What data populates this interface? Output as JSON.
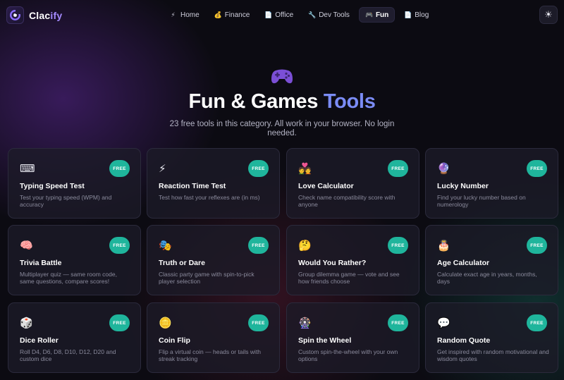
{
  "brand": {
    "name_main": "Clac",
    "name_accent": "ify",
    "logo_icon": "brand-logo-icon"
  },
  "nav": {
    "items": [
      {
        "label": "Home",
        "icon": "⚡",
        "icon_name": "bolt-icon",
        "active": false
      },
      {
        "label": "Finance",
        "icon": "💰",
        "icon_name": "money-bag-icon",
        "active": false
      },
      {
        "label": "Office",
        "icon": "📄",
        "icon_name": "document-icon",
        "active": false
      },
      {
        "label": "Dev Tools",
        "icon": "🔧",
        "icon_name": "wrench-icon",
        "active": false
      },
      {
        "label": "Fun",
        "icon": "🎮",
        "icon_name": "gamepad-icon",
        "active": true
      },
      {
        "label": "Blog",
        "icon": "📄",
        "icon_name": "document-icon",
        "active": false
      }
    ],
    "theme_icon": "☀"
  },
  "hero": {
    "icon": "gamepad-icon",
    "title_main": "Fun & Games ",
    "title_accent": "Tools",
    "subtitle": "23 free tools in this category. All work in your browser. No login needed."
  },
  "colors": {
    "accent": "#7b8cf5",
    "badge": "#1fb59c",
    "brand_accent": "#a58bff",
    "background": "#0c0b12"
  },
  "tools": [
    {
      "title": "Typing Speed Test",
      "desc": "Test your typing speed (WPM) and accuracy",
      "badge": "FREE",
      "icon": "⌨",
      "icon_name": "keyboard-icon"
    },
    {
      "title": "Reaction Time Test",
      "desc": "Test how fast your reflexes are (in ms)",
      "badge": "FREE",
      "icon": "⚡",
      "icon_name": "bolt-icon"
    },
    {
      "title": "Love Calculator",
      "desc": "Check name compatibility score with anyone",
      "badge": "FREE",
      "icon": "💑",
      "icon_name": "couple-heart-icon"
    },
    {
      "title": "Lucky Number",
      "desc": "Find your lucky number based on numerology",
      "badge": "FREE",
      "icon": "🔮",
      "icon_name": "crystal-ball-icon"
    },
    {
      "title": "Trivia Battle",
      "desc": "Multiplayer quiz — same room code, same questions, compare scores!",
      "badge": "FREE",
      "icon": "🧠",
      "icon_name": "brain-icon"
    },
    {
      "title": "Truth or Dare",
      "desc": "Classic party game with spin-to-pick player selection",
      "badge": "FREE",
      "icon": "🎭",
      "icon_name": "theater-masks-icon"
    },
    {
      "title": "Would You Rather?",
      "desc": "Group dilemma game — vote and see how friends choose",
      "badge": "FREE",
      "icon": "🤔",
      "icon_name": "thinking-face-icon"
    },
    {
      "title": "Age Calculator",
      "desc": "Calculate exact age in years, months, days",
      "badge": "FREE",
      "icon": "🎂",
      "icon_name": "birthday-cake-icon"
    },
    {
      "title": "Dice Roller",
      "desc": "Roll D4, D6, D8, D10, D12, D20 and custom dice",
      "badge": "FREE",
      "icon": "🎲",
      "icon_name": "dice-icon"
    },
    {
      "title": "Coin Flip",
      "desc": "Flip a virtual coin — heads or tails with streak tracking",
      "badge": "FREE",
      "icon": "🪙",
      "icon_name": "coin-icon"
    },
    {
      "title": "Spin the Wheel",
      "desc": "Custom spin-the-wheel with your own options",
      "badge": "FREE",
      "icon": "🎡",
      "icon_name": "ferris-wheel-icon"
    },
    {
      "title": "Random Quote",
      "desc": "Get inspired with random motivational and wisdom quotes",
      "badge": "FREE",
      "icon": "💬",
      "icon_name": "speech-bubble-icon"
    }
  ]
}
